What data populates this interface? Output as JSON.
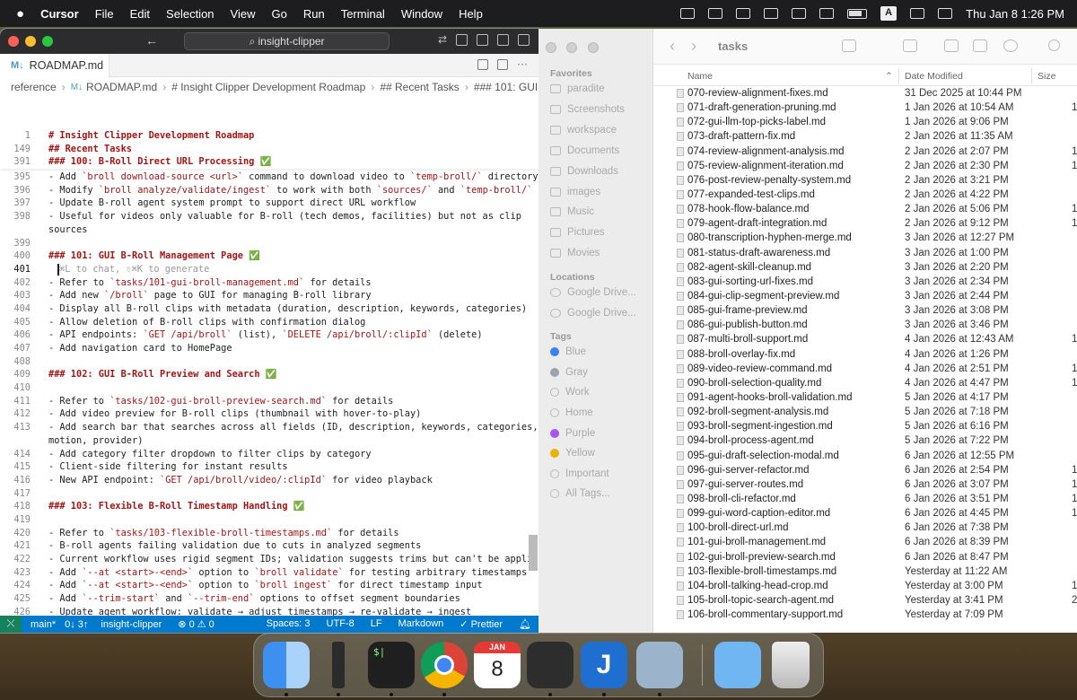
{
  "menubar": {
    "apple_icon": "apple-icon",
    "app_name": "Cursor",
    "menus": [
      "File",
      "Edit",
      "Selection",
      "View",
      "Go",
      "Run",
      "Terminal",
      "Window",
      "Help"
    ],
    "input_indicator": "A",
    "clock": "Thu Jan 8  1:26 PM"
  },
  "editor": {
    "search_text": "insight-clipper",
    "tab_label": "ROADMAP.md",
    "tab_icon": "M↓",
    "breadcrumb": [
      "reference",
      "ROADMAP.md",
      "# Insight Clipper Development Roadmap",
      "## Recent Tasks",
      "### 101: GUI B"
    ],
    "sticky_lines": [
      {
        "n": "1",
        "t": "# Insight Clipper Development Roadmap",
        "h": true
      },
      {
        "n": "149",
        "t": "## Recent Tasks",
        "h": true
      },
      {
        "n": "391",
        "t": "### 100: B-Roll Direct URL Processing ✅",
        "h": true
      }
    ],
    "lines": [
      {
        "n": "395",
        "t": "- Add `broll download-source <url>` command to download video to `temp-broll/` directory"
      },
      {
        "n": "396",
        "t": "- Modify `broll analyze/validate/ingest` to work with both `sources/` and `temp-broll/`"
      },
      {
        "n": "397",
        "t": "- Update B-roll agent system prompt to support direct URL workflow"
      },
      {
        "n": "398",
        "t": "- Useful for videos only valuable for B-roll (tech demos, facilities) but not as clip"
      },
      {
        "n": "",
        "t": "sources"
      },
      {
        "n": "399",
        "t": ""
      },
      {
        "n": "400",
        "t": "### 101: GUI B-Roll Management Page ✅",
        "h": true
      },
      {
        "n": "401",
        "t": "⌘L to chat, ⇧⌘K to generate",
        "ghost": true,
        "cur": true
      },
      {
        "n": "402",
        "t": "- Refer to `tasks/101-gui-broll-management.md` for details"
      },
      {
        "n": "403",
        "t": "- Add new `/broll` page to GUI for managing B-roll library"
      },
      {
        "n": "404",
        "t": "- Display all B-roll clips with metadata (duration, description, keywords, categories)"
      },
      {
        "n": "405",
        "t": "- Allow deletion of B-roll clips with confirmation dialog"
      },
      {
        "n": "406",
        "t": "- API endpoints: `GET /api/broll` (list), `DELETE /api/broll/:clipId` (delete)"
      },
      {
        "n": "407",
        "t": "- Add navigation card to HomePage"
      },
      {
        "n": "408",
        "t": ""
      },
      {
        "n": "409",
        "t": "### 102: GUI B-Roll Preview and Search ✅",
        "h": true
      },
      {
        "n": "410",
        "t": ""
      },
      {
        "n": "411",
        "t": "- Refer to `tasks/102-gui-broll-preview-search.md` for details"
      },
      {
        "n": "412",
        "t": "- Add video preview for B-roll clips (thumbnail with hover-to-play)"
      },
      {
        "n": "413",
        "t": "- Add search bar that searches across all fields (ID, description, keywords, categories,"
      },
      {
        "n": "",
        "t": "motion, provider)"
      },
      {
        "n": "414",
        "t": "- Add category filter dropdown to filter clips by category"
      },
      {
        "n": "415",
        "t": "- Client-side filtering for instant results"
      },
      {
        "n": "416",
        "t": "- New API endpoint: `GET /api/broll/video/:clipId` for video playback"
      },
      {
        "n": "417",
        "t": ""
      },
      {
        "n": "418",
        "t": "### 103: Flexible B-Roll Timestamp Handling ✅",
        "h": true
      },
      {
        "n": "419",
        "t": ""
      },
      {
        "n": "420",
        "t": "- Refer to `tasks/103-flexible-broll-timestamps.md` for details"
      },
      {
        "n": "421",
        "t": "- B-roll agents failing validation due to cuts in analyzed segments"
      },
      {
        "n": "422",
        "t": "- Current workflow uses rigid segment IDs; validation suggests trims but can't be applied"
      },
      {
        "n": "423",
        "t": "- Add `--at <start>-<end>` option to `broll validate` for testing arbitrary timestamps"
      },
      {
        "n": "424",
        "t": "- Add `--at <start>-<end>` option to `broll ingest` for direct timestamp input"
      },
      {
        "n": "425",
        "t": "- Add `--trim-start` and `--trim-end` options to offset segment boundaries"
      },
      {
        "n": "426",
        "t": "- Update agent workflow: validate → adjust timestamps → re-validate → ingest"
      },
      {
        "n": "427",
        "t": "- Enables iterative refinement instead of skip-or-accept binary choice"
      }
    ],
    "status": {
      "branch": "main*",
      "sync": "0↓ 3↑",
      "project": "insight-clipper",
      "problems": "⊗ 0 ⚠ 0",
      "spaces": "Spaces: 3",
      "encoding": "UTF-8",
      "eol": "LF",
      "language": "Markdown",
      "formatter": "✓ Prettier"
    }
  },
  "finder": {
    "title": "tasks",
    "columns": {
      "name": "Name",
      "date": "Date Modified",
      "size": "Size"
    },
    "sidebar": {
      "favorites_label": "Favorites",
      "favorites": [
        "paradite",
        "Screenshots",
        "workspace",
        "Documents",
        "Downloads",
        "images",
        "Music",
        "Pictures",
        "Movies"
      ],
      "locations_label": "Locations",
      "locations": [
        "Google Drive...",
        "Google Drive..."
      ],
      "tags_label": "Tags",
      "tags": [
        {
          "name": "Blue",
          "color": "#3b82f6"
        },
        {
          "name": "Gray",
          "color": "#9ca3af"
        },
        {
          "name": "Work",
          "color": "transparent"
        },
        {
          "name": "Home",
          "color": "transparent"
        },
        {
          "name": "Purple",
          "color": "#a855f7"
        },
        {
          "name": "Yellow",
          "color": "#eab308"
        },
        {
          "name": "Important",
          "color": "transparent"
        },
        {
          "name": "All Tags...",
          "color": "transparent"
        }
      ]
    },
    "files": [
      {
        "name": "070-review-alignment-fixes.md",
        "date": "31 Dec 2025 at 10:44 PM",
        "size": ""
      },
      {
        "name": "071-draft-generation-pruning.md",
        "date": "1 Jan 2026 at 10:54 AM",
        "size": "1"
      },
      {
        "name": "072-gui-llm-top-picks-label.md",
        "date": "1 Jan 2026 at 9:06 PM",
        "size": ""
      },
      {
        "name": "073-draft-pattern-fix.md",
        "date": "2 Jan 2026 at 11:35 AM",
        "size": ""
      },
      {
        "name": "074-review-alignment-analysis.md",
        "date": "2 Jan 2026 at 2:07 PM",
        "size": "1"
      },
      {
        "name": "075-review-alignment-iteration.md",
        "date": "2 Jan 2026 at 2:30 PM",
        "size": "1"
      },
      {
        "name": "076-post-review-penalty-system.md",
        "date": "2 Jan 2026 at 3:21 PM",
        "size": ""
      },
      {
        "name": "077-expanded-test-clips.md",
        "date": "2 Jan 2026 at 4:22 PM",
        "size": ""
      },
      {
        "name": "078-hook-flow-balance.md",
        "date": "2 Jan 2026 at 5:06 PM",
        "size": "1"
      },
      {
        "name": "079-agent-draft-integration.md",
        "date": "2 Jan 2026 at 9:12 PM",
        "size": "1"
      },
      {
        "name": "080-transcription-hyphen-merge.md",
        "date": "3 Jan 2026 at 12:27 PM",
        "size": ""
      },
      {
        "name": "081-status-draft-awareness.md",
        "date": "3 Jan 2026 at 1:00 PM",
        "size": ""
      },
      {
        "name": "082-agent-skill-cleanup.md",
        "date": "3 Jan 2026 at 2:20 PM",
        "size": ""
      },
      {
        "name": "083-gui-sorting-url-fixes.md",
        "date": "3 Jan 2026 at 2:34 PM",
        "size": ""
      },
      {
        "name": "084-gui-clip-segment-preview.md",
        "date": "3 Jan 2026 at 2:44 PM",
        "size": ""
      },
      {
        "name": "085-gui-frame-preview.md",
        "date": "3 Jan 2026 at 3:08 PM",
        "size": ""
      },
      {
        "name": "086-gui-publish-button.md",
        "date": "3 Jan 2026 at 3:46 PM",
        "size": ""
      },
      {
        "name": "087-multi-broll-support.md",
        "date": "4 Jan 2026 at 12:43 AM",
        "size": "1"
      },
      {
        "name": "088-broll-overlay-fix.md",
        "date": "4 Jan 2026 at 1:26 PM",
        "size": ""
      },
      {
        "name": "089-video-review-command.md",
        "date": "4 Jan 2026 at 2:51 PM",
        "size": "1"
      },
      {
        "name": "090-broll-selection-quality.md",
        "date": "4 Jan 2026 at 4:47 PM",
        "size": "1"
      },
      {
        "name": "091-agent-hooks-broll-validation.md",
        "date": "5 Jan 2026 at 4:17 PM",
        "size": ""
      },
      {
        "name": "092-broll-segment-analysis.md",
        "date": "5 Jan 2026 at 7:18 PM",
        "size": ""
      },
      {
        "name": "093-broll-segment-ingestion.md",
        "date": "5 Jan 2026 at 6:16 PM",
        "size": ""
      },
      {
        "name": "094-broll-process-agent.md",
        "date": "5 Jan 2026 at 7:22 PM",
        "size": ""
      },
      {
        "name": "095-gui-draft-selection-modal.md",
        "date": "6 Jan 2026 at 12:55 PM",
        "size": ""
      },
      {
        "name": "096-gui-server-refactor.md",
        "date": "6 Jan 2026 at 2:54 PM",
        "size": "1"
      },
      {
        "name": "097-gui-server-routes.md",
        "date": "6 Jan 2026 at 3:07 PM",
        "size": "1"
      },
      {
        "name": "098-broll-cli-refactor.md",
        "date": "6 Jan 2026 at 3:51 PM",
        "size": "1"
      },
      {
        "name": "099-gui-word-caption-editor.md",
        "date": "6 Jan 2026 at 4:45 PM",
        "size": "1"
      },
      {
        "name": "100-broll-direct-url.md",
        "date": "6 Jan 2026 at 7:38 PM",
        "size": ""
      },
      {
        "name": "101-gui-broll-management.md",
        "date": "6 Jan 2026 at 8:39 PM",
        "size": ""
      },
      {
        "name": "102-gui-broll-preview-search.md",
        "date": "6 Jan 2026 at 8:47 PM",
        "size": ""
      },
      {
        "name": "103-flexible-broll-timestamps.md",
        "date": "Yesterday at 11:22 AM",
        "size": ""
      },
      {
        "name": "104-broll-talking-head-crop.md",
        "date": "Yesterday at 3:00 PM",
        "size": "1"
      },
      {
        "name": "105-broll-topic-search-agent.md",
        "date": "Yesterday at 3:41 PM",
        "size": "2"
      },
      {
        "name": "106-broll-commentary-support.md",
        "date": "Yesterday at 7:09 PM",
        "size": ""
      }
    ]
  },
  "dock": {
    "apps": [
      {
        "icon": "finder-icon",
        "color": "#4fa3f7"
      },
      {
        "icon": "activity-monitor-icon",
        "color": "#2b2b2b"
      },
      {
        "icon": "terminal-icon",
        "color": "#1f1f1f"
      },
      {
        "icon": "chrome-icon",
        "color": "#e8e8e8"
      },
      {
        "icon": "calendar-icon",
        "color": "#ffffff"
      },
      {
        "icon": "cursor-icon",
        "color": "#2d2d2d"
      },
      {
        "icon": "joplin-icon",
        "color": "#1f6fd1"
      },
      {
        "icon": "preview-icon",
        "color": "#9bb4cc"
      },
      {
        "icon": "downloads-folder-icon",
        "color": "#6fb6f2"
      },
      {
        "icon": "trash-icon",
        "color": "#d9d9d9"
      }
    ],
    "calendar_month": "JAN",
    "calendar_day": "8",
    "terminal_prompt": "$|"
  }
}
